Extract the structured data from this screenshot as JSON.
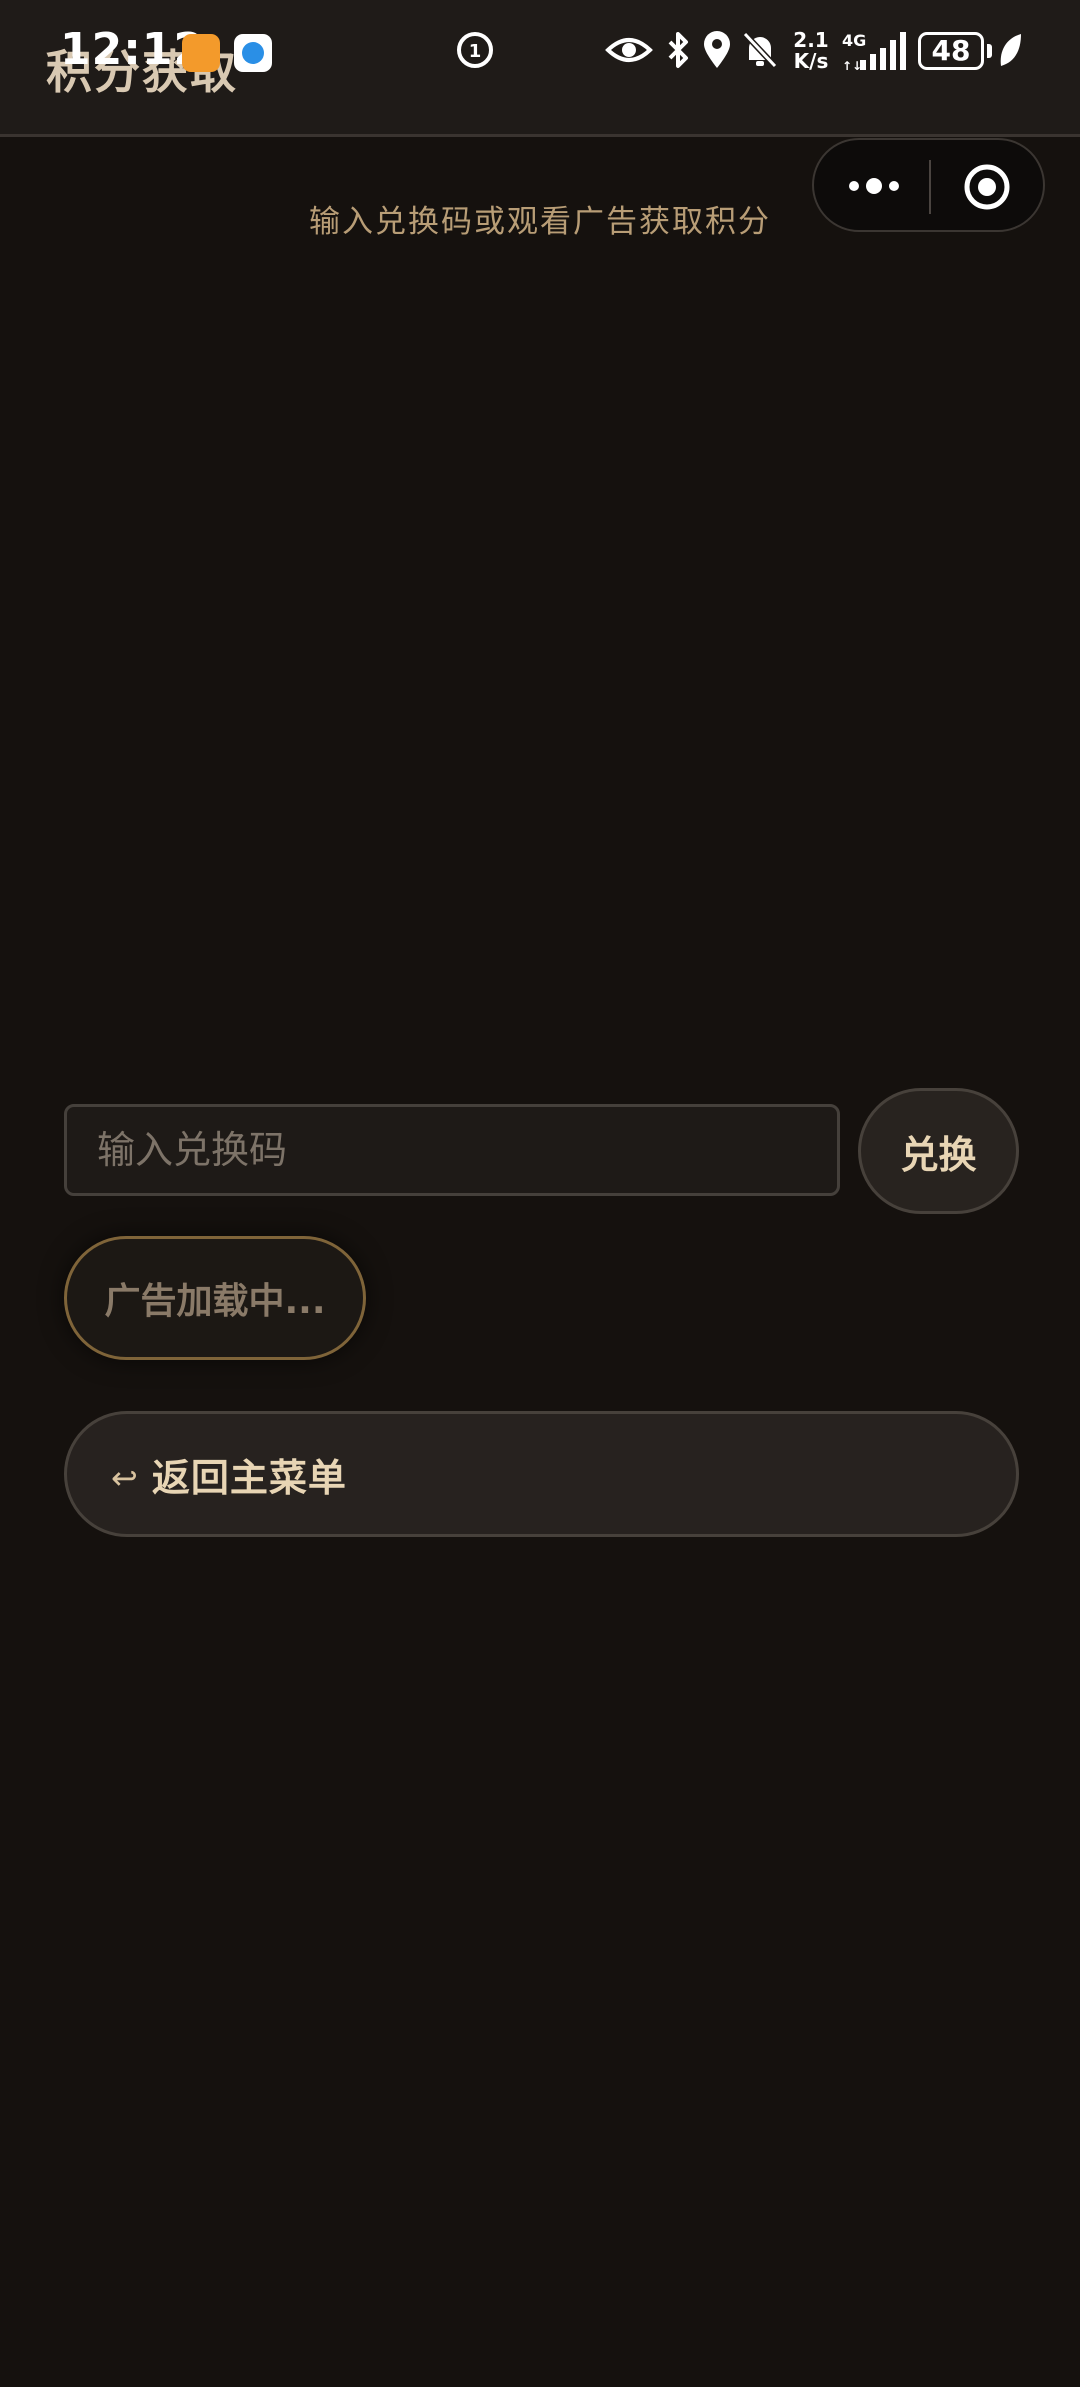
{
  "status_bar": {
    "time": "12:12",
    "network_speed_value": "2.1",
    "network_speed_unit": "K/s",
    "network_type": "4G",
    "battery": "48",
    "icons": [
      "app-icon-orange",
      "app-icon-blue",
      "screen-record-icon",
      "eye-icon",
      "bluetooth-icon",
      "location-icon",
      "mute-bell-icon",
      "signal-icon",
      "leaf-icon"
    ]
  },
  "header": {
    "title": "积分获取"
  },
  "capsule": {
    "more_icon": "more-dots-icon",
    "close_icon": "target-close-icon"
  },
  "main": {
    "subtitle": "输入兑换码或观看广告获取积分",
    "redeem_input": {
      "value": "",
      "placeholder": "输入兑换码"
    },
    "redeem_button": "兑换",
    "ad_button": "广告加载中...",
    "back_button": {
      "icon": "↩",
      "label": "返回主菜单"
    }
  },
  "colors": {
    "background": "#15110e",
    "accent_text": "#e8d5b4",
    "subtitle": "#b89d76",
    "ad_border": "#7f6439"
  }
}
